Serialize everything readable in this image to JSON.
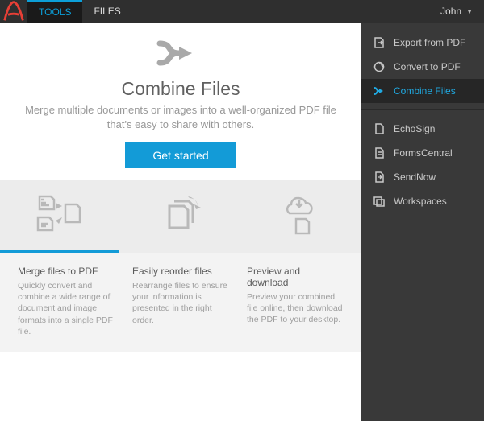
{
  "topbar": {
    "tabs": [
      {
        "label": "TOOLS",
        "active": true
      },
      {
        "label": "FILES",
        "active": false
      }
    ],
    "user": "John"
  },
  "hero": {
    "title": "Combine Files",
    "subtitle": "Merge multiple documents or images into a well-organized PDF file that's easy to share with others.",
    "button": "Get started"
  },
  "features": [
    {
      "title": "Merge files to PDF",
      "desc": "Quickly convert and combine a wide range of document and image formats into a single PDF file."
    },
    {
      "title": "Easily reorder files",
      "desc": "Rearrange files to ensure your information is presented in the right order."
    },
    {
      "title": "Preview and download",
      "desc": "Preview your combined file online, then download the PDF to your desktop."
    }
  ],
  "sidebar": {
    "top": [
      {
        "label": "Export from PDF"
      },
      {
        "label": "Convert to PDF"
      },
      {
        "label": "Combine Files"
      }
    ],
    "bottom": [
      {
        "label": "EchoSign"
      },
      {
        "label": "FormsCentral"
      },
      {
        "label": "SendNow"
      },
      {
        "label": "Workspaces"
      }
    ]
  }
}
